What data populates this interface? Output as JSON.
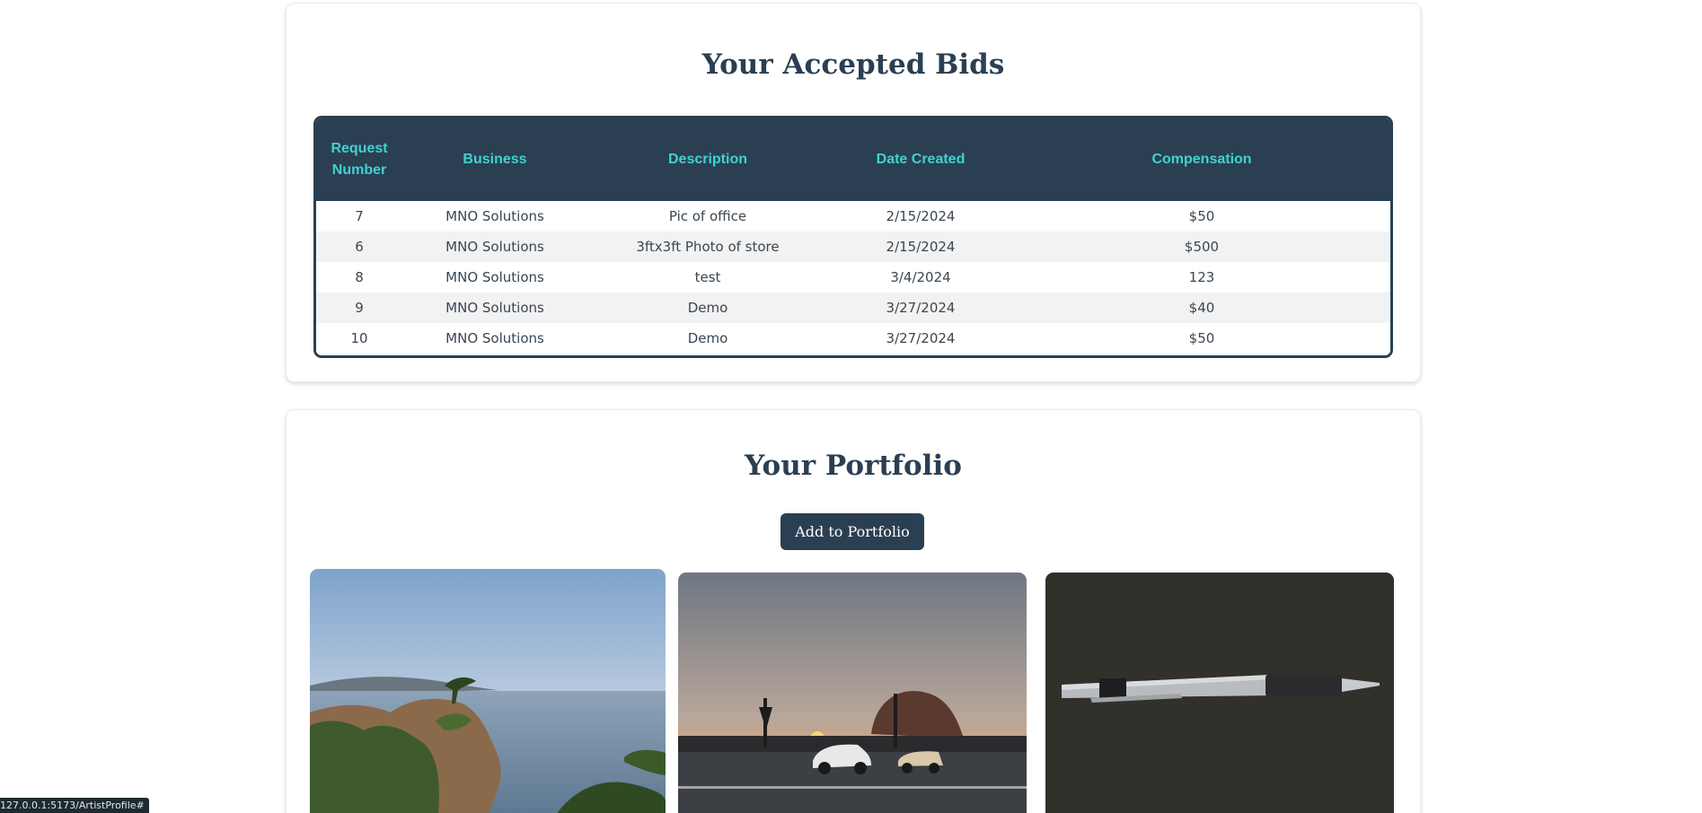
{
  "bids_section": {
    "title": "Your Accepted Bids",
    "columns": [
      "Request Number",
      "Business",
      "Description",
      "Date Created",
      "Compensation"
    ],
    "rows": [
      [
        "7",
        "MNO Solutions",
        "Pic of office",
        "2/15/2024",
        "$50"
      ],
      [
        "6",
        "MNO Solutions",
        "3ftx3ft Photo of store",
        "2/15/2024",
        "$500"
      ],
      [
        "8",
        "MNO Solutions",
        "test",
        "3/4/2024",
        "123"
      ],
      [
        "9",
        "MNO Solutions",
        "Demo",
        "3/27/2024",
        "$40"
      ],
      [
        "10",
        "MNO Solutions",
        "Demo",
        "3/27/2024",
        "$50"
      ]
    ]
  },
  "portfolio_section": {
    "title": "Your Portfolio",
    "add_button_label": "Add to Portfolio",
    "images": [
      {
        "subject": "coastal-cypress-photo"
      },
      {
        "subject": "harbor-sunset-photo"
      },
      {
        "subject": "pen-photo"
      }
    ]
  },
  "status_bar": {
    "url": "127.0.0.1:5173/ArtistProfile#"
  },
  "colors": {
    "primary": "#2b3f52",
    "header_text": "#3fd3d0",
    "stripe": "#f2f2f2"
  }
}
